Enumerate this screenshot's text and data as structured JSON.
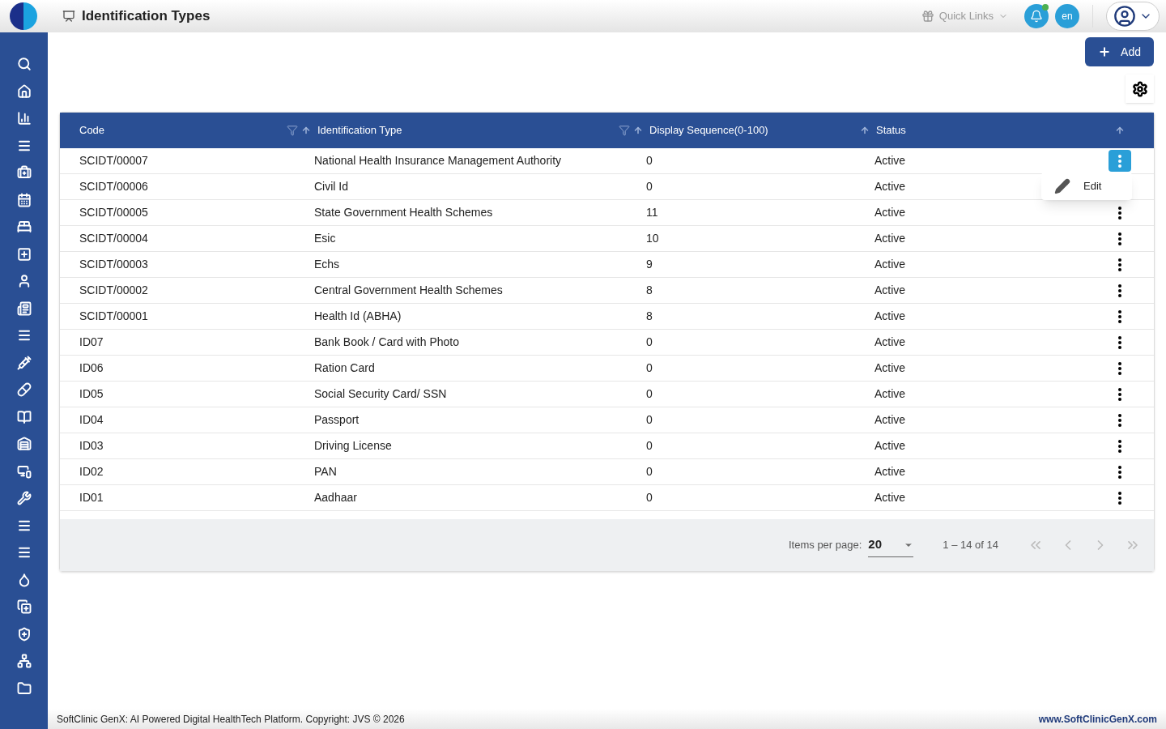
{
  "header": {
    "title": "Identification Types",
    "quick_links": "Quick Links",
    "notifications_unread": true,
    "language": "en"
  },
  "toolbar": {
    "add_label": "Add"
  },
  "table": {
    "columns": [
      {
        "label": "Code",
        "filter": false,
        "sort": false
      },
      {
        "label": "Identification Type",
        "filter": true,
        "sort": true
      },
      {
        "label": "Display Sequence(0-100)",
        "filter": true,
        "sort": true
      },
      {
        "label": "Status",
        "filter": false,
        "sort": true
      }
    ],
    "actions_sort": true,
    "rows": [
      {
        "code": "SCIDT/00007",
        "type": "National Health Insurance Management Authority",
        "sequence": "0",
        "status": "Active",
        "menu_open": true
      },
      {
        "code": "SCIDT/00006",
        "type": "Civil Id",
        "sequence": "0",
        "status": "Active",
        "menu_open": false
      },
      {
        "code": "SCIDT/00005",
        "type": "State Government Health Schemes",
        "sequence": "11",
        "status": "Active",
        "menu_open": false
      },
      {
        "code": "SCIDT/00004",
        "type": "Esic",
        "sequence": "10",
        "status": "Active",
        "menu_open": false
      },
      {
        "code": "SCIDT/00003",
        "type": "Echs",
        "sequence": "9",
        "status": "Active",
        "menu_open": false
      },
      {
        "code": "SCIDT/00002",
        "type": "Central Government Health Schemes",
        "sequence": "8",
        "status": "Active",
        "menu_open": false
      },
      {
        "code": "SCIDT/00001",
        "type": "Health Id (ABHA)",
        "sequence": "8",
        "status": "Active",
        "menu_open": false
      },
      {
        "code": "ID07",
        "type": "Bank Book / Card with Photo",
        "sequence": "0",
        "status": "Active",
        "menu_open": false
      },
      {
        "code": "ID06",
        "type": "Ration Card",
        "sequence": "0",
        "status": "Active",
        "menu_open": false
      },
      {
        "code": "ID05",
        "type": "Social Security Card/ SSN",
        "sequence": "0",
        "status": "Active",
        "menu_open": false
      },
      {
        "code": "ID04",
        "type": "Passport",
        "sequence": "0",
        "status": "Active",
        "menu_open": false
      },
      {
        "code": "ID03",
        "type": "Driving License",
        "sequence": "0",
        "status": "Active",
        "menu_open": false
      },
      {
        "code": "ID02",
        "type": "PAN",
        "sequence": "0",
        "status": "Active",
        "menu_open": false
      },
      {
        "code": "ID01",
        "type": "Aadhaar",
        "sequence": "0",
        "status": "Active",
        "menu_open": false
      }
    ],
    "row_menu": [
      "Edit"
    ]
  },
  "paginator": {
    "label": "Items per page:",
    "page_size": "20",
    "range": "1 – 14 of 14"
  },
  "footer": {
    "copyright": "SoftClinic GenX: AI Powered Digital HealthTech Platform. Copyright: JVS © 2026",
    "link": "www.SoftClinicGenX.com"
  }
}
